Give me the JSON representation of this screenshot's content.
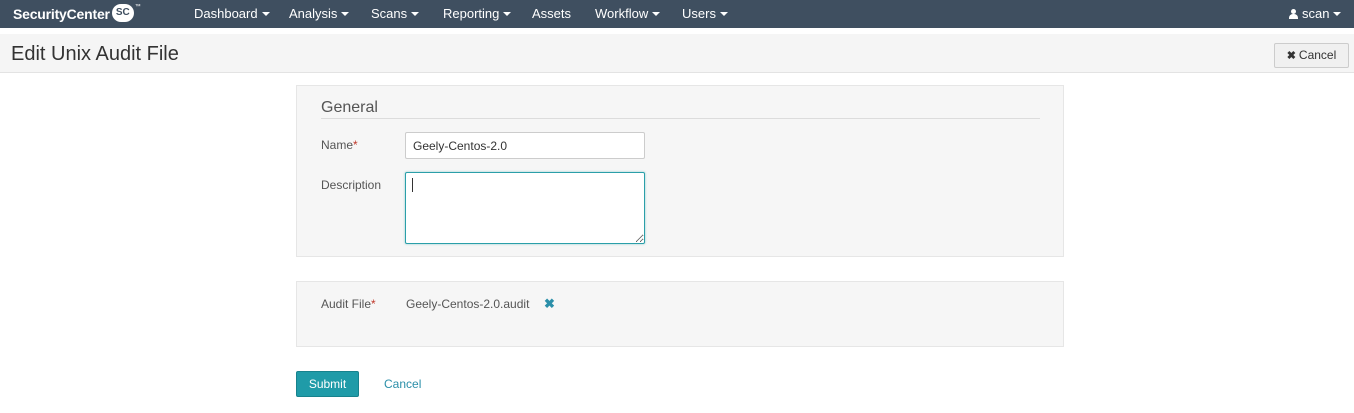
{
  "navbar": {
    "brand_text": "SecurityCenter",
    "brand_badge": "SC",
    "brand_tm": "™",
    "items": [
      {
        "label": "Dashboard",
        "dropdown": true
      },
      {
        "label": "Analysis",
        "dropdown": true
      },
      {
        "label": "Scans",
        "dropdown": true
      },
      {
        "label": "Reporting",
        "dropdown": true
      },
      {
        "label": "Assets",
        "dropdown": false
      },
      {
        "label": "Workflow",
        "dropdown": true
      },
      {
        "label": "Users",
        "dropdown": true
      }
    ],
    "user": {
      "label": "scan",
      "icon": "user-icon"
    },
    "background_color": "#3f4f60"
  },
  "page": {
    "title": "Edit Unix Audit File",
    "cancel_label": "Cancel"
  },
  "general": {
    "legend": "General",
    "name_label": "Name",
    "required_marker": "*",
    "name_value": "Geely-Centos-2.0",
    "description_label": "Description",
    "description_value": ""
  },
  "audit": {
    "label": "Audit File",
    "required_marker": "*",
    "file_name": "Geely-Centos-2.0.audit",
    "remove_icon": "close-icon"
  },
  "actions": {
    "submit_label": "Submit",
    "cancel_label": "Cancel",
    "accent_color": "#1f9ba8"
  }
}
